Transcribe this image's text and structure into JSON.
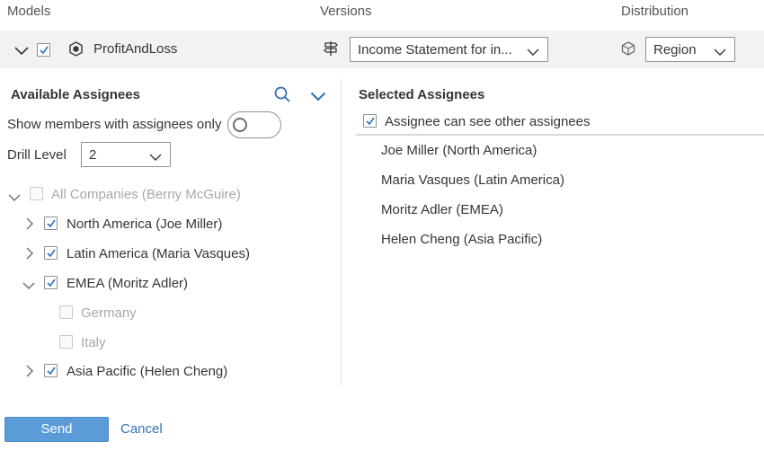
{
  "headers": {
    "models": "Models",
    "versions": "Versions",
    "distribution": "Distribution"
  },
  "model": {
    "name": "ProfitAndLoss",
    "checked": true
  },
  "version_select": {
    "value": "Income Statement for in..."
  },
  "distribution_select": {
    "value": "Region"
  },
  "available": {
    "title": "Available Assignees",
    "show_members_label": "Show members with assignees only",
    "toggle_on": false,
    "drill_level_label": "Drill Level",
    "drill_level_value": "2",
    "tree": [
      {
        "label": "All Companies (Berny McGuire)",
        "checked": false,
        "disabled": true,
        "expanded": true,
        "level": 0
      },
      {
        "label": "North America (Joe Miller)",
        "checked": true,
        "disabled": false,
        "expanded": false,
        "level": 1
      },
      {
        "label": "Latin America (Maria Vasques)",
        "checked": true,
        "disabled": false,
        "expanded": false,
        "level": 1
      },
      {
        "label": "EMEA (Moritz Adler)",
        "checked": true,
        "disabled": false,
        "expanded": true,
        "level": 1
      },
      {
        "label": "Germany",
        "checked": false,
        "disabled": true,
        "level": 2
      },
      {
        "label": "Italy",
        "checked": false,
        "disabled": true,
        "level": 2
      },
      {
        "label": "Asia Pacific (Helen Cheng)",
        "checked": true,
        "disabled": false,
        "expanded": false,
        "level": 1
      }
    ]
  },
  "selected": {
    "title": "Selected Assignees",
    "see_others_label": "Assignee can see other assignees",
    "see_others_checked": true,
    "items": [
      "Joe Miller (North America)",
      "Maria Vasques (Latin America)",
      "Moritz Adler (EMEA)",
      "Helen Cheng (Asia Pacific)"
    ]
  },
  "actions": {
    "send": "Send",
    "cancel": "Cancel"
  },
  "colors": {
    "accent": "#2e6fb7",
    "send_bg": "#5a9bd8",
    "row_bg": "#f2f2f2"
  }
}
